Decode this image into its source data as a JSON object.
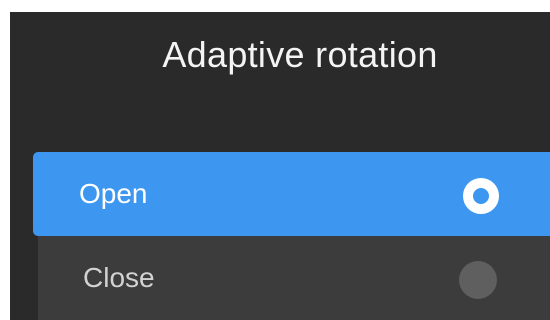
{
  "dialog": {
    "title": "Adaptive rotation",
    "options": [
      {
        "label": "Open",
        "selected": true
      },
      {
        "label": "Close",
        "selected": false
      }
    ]
  },
  "colors": {
    "background": "#2a2a2a",
    "accent": "#3d97f0",
    "unselected_row": "#3c3c3c",
    "unselected_radio": "#5f5f5f"
  },
  "icons": {
    "selected_radio": "radio-selected-icon",
    "unselected_radio": "radio-unselected-icon"
  }
}
